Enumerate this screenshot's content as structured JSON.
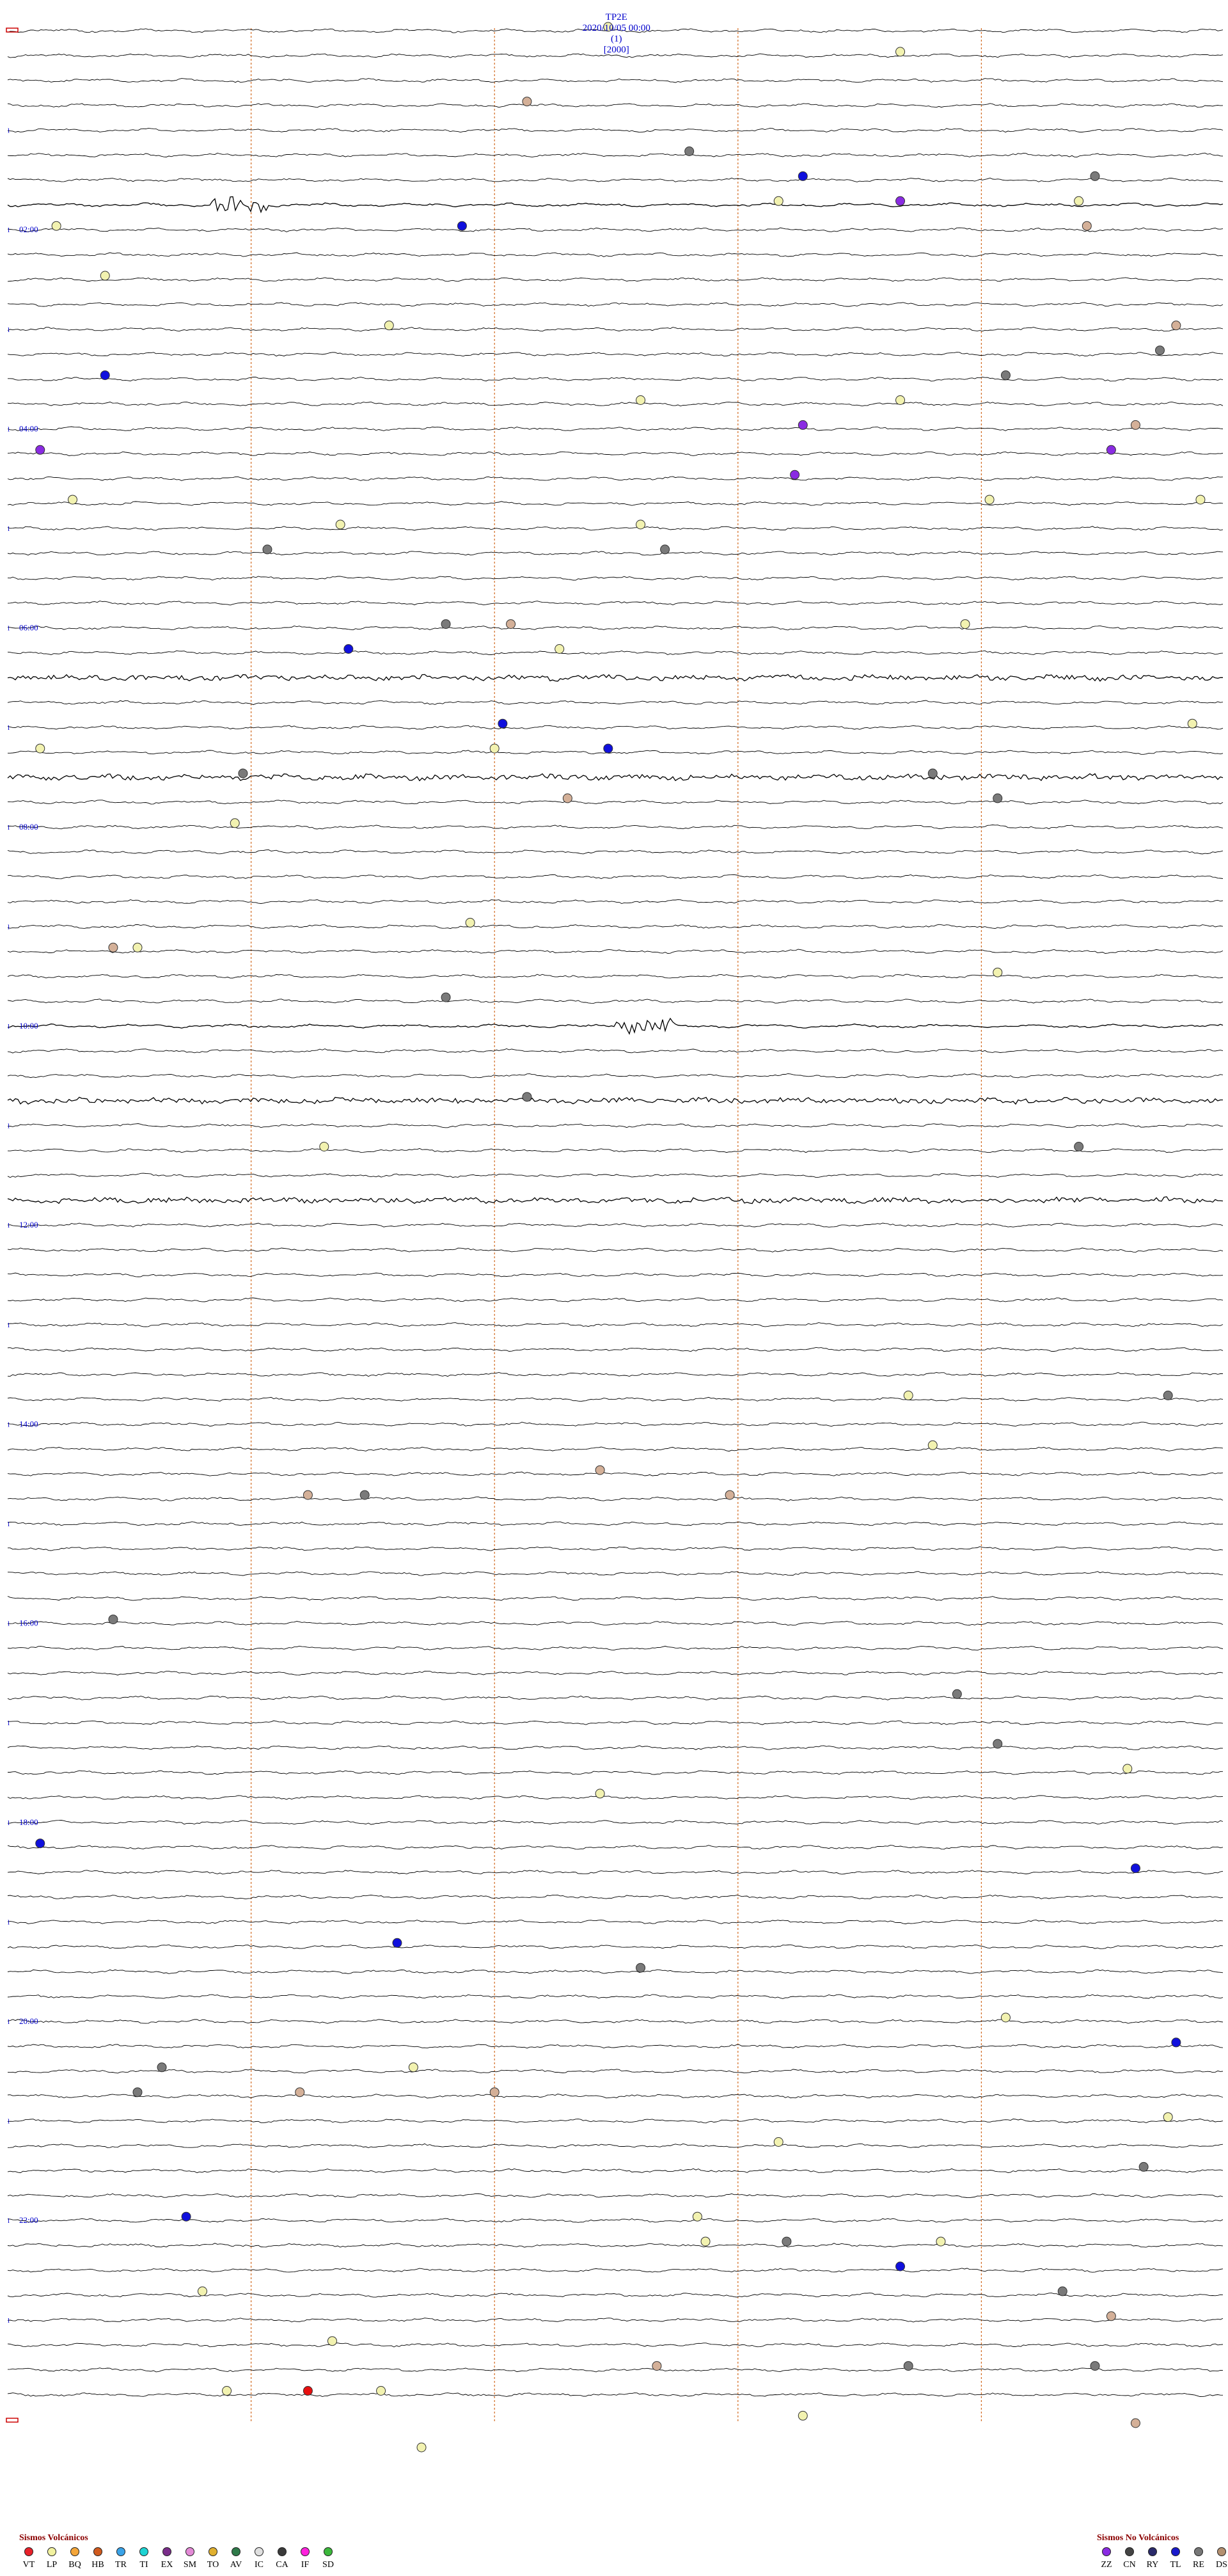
{
  "header": {
    "station": "TP2E",
    "datetime": "2020/10/05 00:00",
    "index": "(1)",
    "scale": "[2000]"
  },
  "chart_data": {
    "type": "helicorder",
    "traces_per_hour": 4,
    "minutes_per_trace": 15,
    "total_traces": 96,
    "minute_gridlines": [
      3,
      6,
      9,
      12
    ],
    "time_labels": [
      "02:00",
      "04:00",
      "06:00",
      "08:00",
      "10:00",
      "12:00",
      "14:00",
      "16:00",
      "18:00",
      "20:00",
      "22:00"
    ],
    "noisy_traces": [
      {
        "trace": 7,
        "level": "event",
        "minute_from": 2.5,
        "minute_to": 3.2
      },
      {
        "trace": 26,
        "level": "high"
      },
      {
        "trace": 30,
        "level": "high"
      },
      {
        "trace": 40,
        "level": "event",
        "minute_from": 7.5,
        "minute_to": 8.2
      },
      {
        "trace": 43,
        "level": "high"
      },
      {
        "trace": 47,
        "level": "high"
      }
    ],
    "events": [
      {
        "trace": 0,
        "minute": 7.4,
        "type": "LP"
      },
      {
        "trace": 1,
        "minute": 11.0,
        "type": "LP"
      },
      {
        "trace": 3,
        "minute": 6.4,
        "type": "DS"
      },
      {
        "trace": 5,
        "minute": 8.4,
        "type": "IC"
      },
      {
        "trace": 6,
        "minute": 9.8,
        "type": "TL"
      },
      {
        "trace": 6,
        "minute": 13.4,
        "type": "IC"
      },
      {
        "trace": 7,
        "minute": 9.5,
        "type": "LP"
      },
      {
        "trace": 7,
        "minute": 11.0,
        "type": "EX"
      },
      {
        "trace": 7,
        "minute": 13.2,
        "type": "LP"
      },
      {
        "trace": 8,
        "minute": 0.6,
        "type": "LP"
      },
      {
        "trace": 8,
        "minute": 5.6,
        "type": "TL"
      },
      {
        "trace": 8,
        "minute": 13.3,
        "type": "DS"
      },
      {
        "trace": 10,
        "minute": 1.2,
        "type": "LP"
      },
      {
        "trace": 12,
        "minute": 4.7,
        "type": "LP"
      },
      {
        "trace": 12,
        "minute": 14.4,
        "type": "DS"
      },
      {
        "trace": 13,
        "minute": 14.2,
        "type": "IC"
      },
      {
        "trace": 14,
        "minute": 1.2,
        "type": "TL"
      },
      {
        "trace": 14,
        "minute": 12.3,
        "type": "IC"
      },
      {
        "trace": 15,
        "minute": 7.8,
        "type": "LP"
      },
      {
        "trace": 15,
        "minute": 11.0,
        "type": "LP"
      },
      {
        "trace": 16,
        "minute": 9.8,
        "type": "EX"
      },
      {
        "trace": 16,
        "minute": 13.9,
        "type": "DS"
      },
      {
        "trace": 17,
        "minute": 0.4,
        "type": "EX"
      },
      {
        "trace": 17,
        "minute": 13.6,
        "type": "EX"
      },
      {
        "trace": 18,
        "minute": 9.7,
        "type": "EX"
      },
      {
        "trace": 19,
        "minute": 0.8,
        "type": "LP"
      },
      {
        "trace": 19,
        "minute": 12.1,
        "type": "LP"
      },
      {
        "trace": 19,
        "minute": 14.7,
        "type": "LP"
      },
      {
        "trace": 20,
        "minute": 4.1,
        "type": "LP"
      },
      {
        "trace": 20,
        "minute": 7.8,
        "type": "LP"
      },
      {
        "trace": 21,
        "minute": 8.1,
        "type": "IC"
      },
      {
        "trace": 21,
        "minute": 3.2,
        "type": "IC"
      },
      {
        "trace": 24,
        "minute": 6.2,
        "type": "DS"
      },
      {
        "trace": 24,
        "minute": 5.4,
        "type": "IC"
      },
      {
        "trace": 24,
        "minute": 11.8,
        "type": "LP"
      },
      {
        "trace": 25,
        "minute": 4.2,
        "type": "TL"
      },
      {
        "trace": 25,
        "minute": 6.8,
        "type": "LP"
      },
      {
        "trace": 28,
        "minute": 6.1,
        "type": "TL"
      },
      {
        "trace": 28,
        "minute": 14.6,
        "type": "LP"
      },
      {
        "trace": 29,
        "minute": 0.4,
        "type": "LP"
      },
      {
        "trace": 29,
        "minute": 6.0,
        "type": "LP"
      },
      {
        "trace": 29,
        "minute": 7.4,
        "type": "TL"
      },
      {
        "trace": 30,
        "minute": 2.9,
        "type": "IC"
      },
      {
        "trace": 30,
        "minute": 11.4,
        "type": "IC"
      },
      {
        "trace": 31,
        "minute": 6.9,
        "type": "DS"
      },
      {
        "trace": 31,
        "minute": 12.2,
        "type": "IC"
      },
      {
        "trace": 32,
        "minute": 2.8,
        "type": "LP"
      },
      {
        "trace": 36,
        "minute": 5.7,
        "type": "LP"
      },
      {
        "trace": 37,
        "minute": 1.3,
        "type": "DS"
      },
      {
        "trace": 37,
        "minute": 1.6,
        "type": "LP"
      },
      {
        "trace": 38,
        "minute": 12.2,
        "type": "LP"
      },
      {
        "trace": 39,
        "minute": 5.4,
        "type": "IC"
      },
      {
        "trace": 43,
        "minute": 6.4,
        "type": "IC"
      },
      {
        "trace": 45,
        "minute": 3.9,
        "type": "LP"
      },
      {
        "trace": 45,
        "minute": 13.2,
        "type": "IC"
      },
      {
        "trace": 55,
        "minute": 14.3,
        "type": "IC"
      },
      {
        "trace": 55,
        "minute": 11.1,
        "type": "LP"
      },
      {
        "trace": 57,
        "minute": 11.4,
        "type": "LP"
      },
      {
        "trace": 58,
        "minute": 7.3,
        "type": "DS"
      },
      {
        "trace": 59,
        "minute": 4.4,
        "type": "IC"
      },
      {
        "trace": 59,
        "minute": 3.7,
        "type": "DS"
      },
      {
        "trace": 59,
        "minute": 8.9,
        "type": "DS"
      },
      {
        "trace": 64,
        "minute": 1.3,
        "type": "IC"
      },
      {
        "trace": 67,
        "minute": 11.7,
        "type": "IC"
      },
      {
        "trace": 69,
        "minute": 12.2,
        "type": "IC"
      },
      {
        "trace": 70,
        "minute": 13.8,
        "type": "LP"
      },
      {
        "trace": 71,
        "minute": 7.3,
        "type": "LP"
      },
      {
        "trace": 73,
        "minute": 0.4,
        "type": "TL"
      },
      {
        "trace": 74,
        "minute": 13.9,
        "type": "TL"
      },
      {
        "trace": 77,
        "minute": 4.8,
        "type": "TL"
      },
      {
        "trace": 78,
        "minute": 7.8,
        "type": "IC"
      },
      {
        "trace": 80,
        "minute": 12.3,
        "type": "LP"
      },
      {
        "trace": 81,
        "minute": 14.4,
        "type": "TL"
      },
      {
        "trace": 82,
        "minute": 1.9,
        "type": "IC"
      },
      {
        "trace": 82,
        "minute": 5.0,
        "type": "LP"
      },
      {
        "trace": 83,
        "minute": 1.6,
        "type": "IC"
      },
      {
        "trace": 83,
        "minute": 3.6,
        "type": "DS"
      },
      {
        "trace": 83,
        "minute": 6.0,
        "type": "DS"
      },
      {
        "trace": 84,
        "minute": 14.3,
        "type": "LP"
      },
      {
        "trace": 85,
        "minute": 9.5,
        "type": "LP"
      },
      {
        "trace": 86,
        "minute": 14.0,
        "type": "IC"
      },
      {
        "trace": 88,
        "minute": 8.5,
        "type": "LP"
      },
      {
        "trace": 88,
        "minute": 2.2,
        "type": "TL"
      },
      {
        "trace": 89,
        "minute": 8.6,
        "type": "LP"
      },
      {
        "trace": 89,
        "minute": 9.6,
        "type": "IC"
      },
      {
        "trace": 89,
        "minute": 11.5,
        "type": "LP"
      },
      {
        "trace": 90,
        "minute": 11.0,
        "type": "TL"
      },
      {
        "trace": 91,
        "minute": 13.0,
        "type": "IC"
      },
      {
        "trace": 91,
        "minute": 2.4,
        "type": "LP"
      },
      {
        "trace": 92,
        "minute": 13.6,
        "type": "DS"
      },
      {
        "trace": 93,
        "minute": 4.0,
        "type": "LP"
      },
      {
        "trace": 94,
        "minute": 11.1,
        "type": "IC"
      },
      {
        "trace": 94,
        "minute": 13.4,
        "type": "IC"
      },
      {
        "trace": 94,
        "minute": 8.0,
        "type": "DS"
      },
      {
        "trace": 95,
        "minute": 2.7,
        "type": "LP"
      },
      {
        "trace": 95,
        "minute": 3.7,
        "type": "VT"
      },
      {
        "trace": 95,
        "minute": 4.6,
        "type": "LP"
      },
      {
        "trace": 96,
        "minute": 9.8,
        "type": "LP"
      }
    ],
    "trailing_events": [
      {
        "minute": 13.9,
        "type": "DS"
      },
      {
        "minute": 5.1,
        "type": "LP"
      }
    ]
  },
  "legend_volcanic": {
    "title": "Sismos Volcánicos",
    "items": [
      {
        "code": "VT",
        "color": "#e8212a"
      },
      {
        "code": "LP",
        "color": "#f2f2a0"
      },
      {
        "code": "BQ",
        "color": "#f4a63a"
      },
      {
        "code": "HB",
        "color": "#d05a1e"
      },
      {
        "code": "TR",
        "color": "#3aa3e8"
      },
      {
        "code": "TI",
        "color": "#1ed3d3"
      },
      {
        "code": "EX",
        "color": "#7a2d8a"
      },
      {
        "code": "SM",
        "color": "#e38ad6"
      },
      {
        "code": "TO",
        "color": "#e0b030"
      },
      {
        "code": "AV",
        "color": "#2f7a4a"
      },
      {
        "code": "IC",
        "color": "#e0e0e0"
      },
      {
        "code": "CA",
        "color": "#3a3a3a"
      },
      {
        "code": "IF",
        "color": "#ff22dd"
      },
      {
        "code": "SD",
        "color": "#3cb83c"
      }
    ]
  },
  "legend_novolcanic": {
    "title": "Sismos No Volcánicos",
    "items": [
      {
        "code": "ZZ",
        "color": "#8a2be2"
      },
      {
        "code": "CN",
        "color": "#444444"
      },
      {
        "code": "RY",
        "color": "#2a2a6a"
      },
      {
        "code": "TL",
        "color": "#1a1acc"
      },
      {
        "code": "RE",
        "color": "#777777"
      },
      {
        "code": "DS",
        "color": "#b49070"
      }
    ]
  },
  "event_colors": {
    "VT": "#e81010",
    "LP": "#f2f2b0",
    "EX": "#8a2be2",
    "TL": "#1010dd",
    "IC": "#7a7a7a",
    "DS": "#d4b098"
  }
}
